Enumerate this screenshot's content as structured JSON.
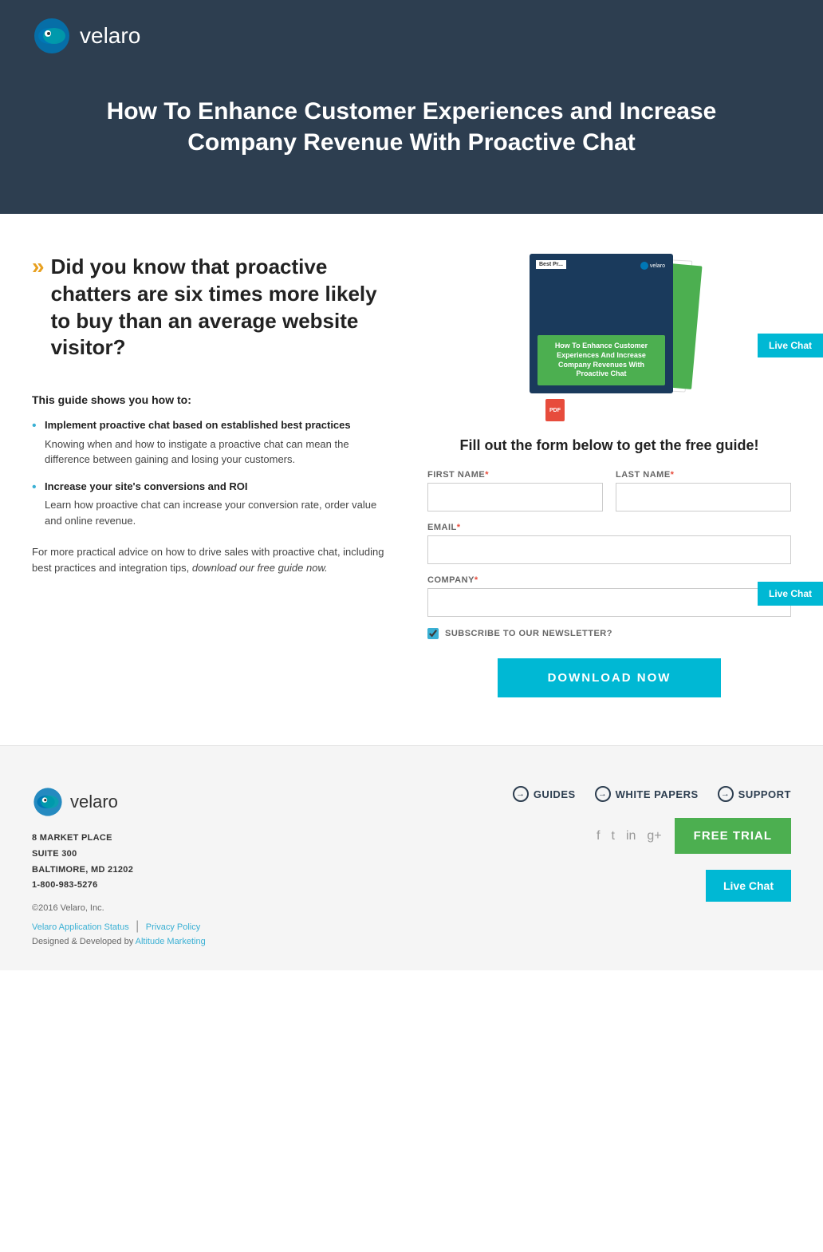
{
  "header": {
    "logo_text": "velaro",
    "title": "How To Enhance Customer Experiences and Increase Company Revenue With Proactive Chat"
  },
  "main": {
    "big_question": "Did you know that proactive chatters are six times more likely to buy than an average website visitor?",
    "guide_shows": "This guide shows you how to:",
    "bullets": [
      {
        "title": "Implement proactive chat based on established best practices",
        "desc": "Knowing when and how to instigate a proactive chat can mean the difference between gaining and losing your customers."
      },
      {
        "title": "Increase your site's conversions and ROI",
        "desc": "Learn how proactive chat can increase your conversion rate, order value and online revenue."
      }
    ],
    "bottom_text_prefix": "For more practical advice on how to drive sales with proactive chat, including best practices and integration tips, ",
    "bottom_text_italic": "download our free guide now.",
    "form_title": "Fill out the form below to get the free guide!",
    "form": {
      "first_name_label": "FIRST NAME",
      "last_name_label": "LAST NAME",
      "email_label": "EMAIL",
      "company_label": "COMPANY",
      "newsletter_label": "SUBSCRIBE TO OUR NEWSLETTER?",
      "download_btn": "DOWNLOAD NOW"
    },
    "book": {
      "best_pr": "Best Pr...",
      "logo": "velaro",
      "front_text": "How To Enhance Customer Experiences And Increase Company Revenues With Proactive Chat"
    }
  },
  "live_chat": {
    "label": "Live Chat"
  },
  "footer": {
    "logo_text": "velaro",
    "address": {
      "line1": "8 MARKET PLACE",
      "line2": "SUITE 300",
      "line3": "BALTIMORE, MD 21202",
      "line4": "1-800-983-5276"
    },
    "copy": "©2016 Velaro, Inc.",
    "link1": "Velaro Application Status",
    "link2": "Privacy Policy",
    "dev": "Designed & Developed by ",
    "dev_link": "Altitude Marketing",
    "nav": [
      {
        "label": "GUIDES"
      },
      {
        "label": "WHITE PAPERS"
      },
      {
        "label": "SUPPORT"
      }
    ],
    "social": [
      "f",
      "t",
      "in",
      "g+"
    ],
    "free_trial": "FREE TRIAL"
  }
}
